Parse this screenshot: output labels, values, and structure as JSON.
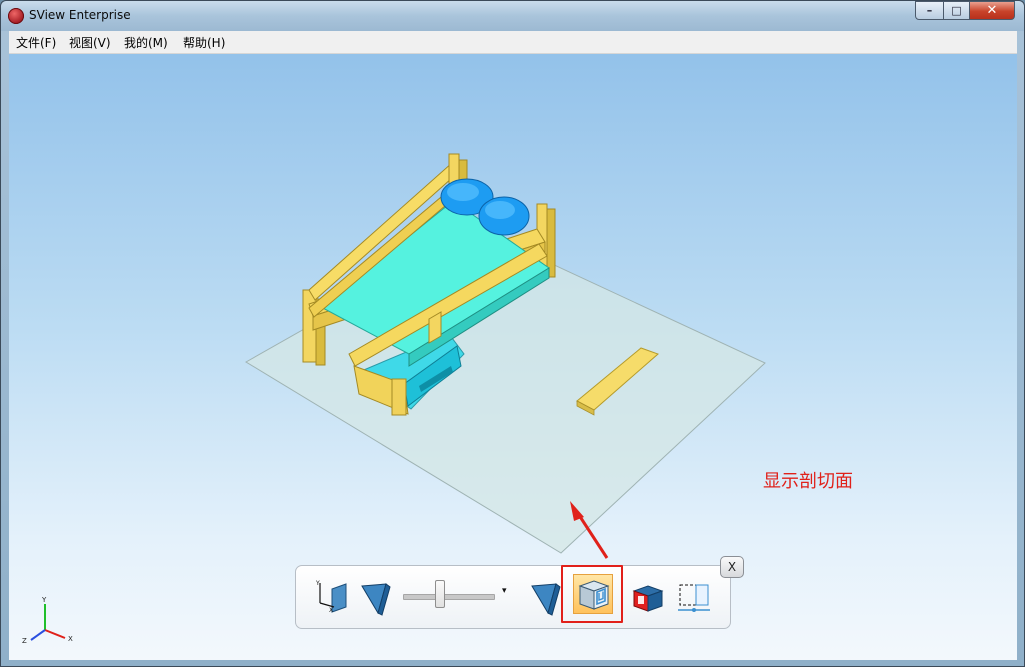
{
  "window": {
    "title": "SView Enterprise",
    "controls": {
      "minimize": "–",
      "maximize": "□",
      "close": "✕"
    }
  },
  "menu": {
    "items": [
      "文件(F)",
      "视图(V)",
      "我的(M)",
      "帮助(H)"
    ]
  },
  "annotation": {
    "text": "显示剖切面",
    "color": "#e0211a"
  },
  "axis_triad": {
    "labels": [
      "Y",
      "X",
      "Z"
    ]
  },
  "section_toolbar": {
    "close_label": "X",
    "buttons": [
      {
        "icon": "plane-xy-icon"
      },
      {
        "icon": "section-plane-icon"
      },
      {
        "icon": "slider"
      },
      {
        "icon": "dropdown-arrow-icon"
      },
      {
        "icon": "section-plane-icon"
      },
      {
        "icon": "show-section-icon",
        "active": true
      },
      {
        "icon": "section-cap-icon"
      },
      {
        "icon": "section-edge-icon"
      }
    ],
    "slider_value": 0.4
  },
  "colors": {
    "annotation_red": "#e0211a",
    "active_button": "#ffc25c",
    "mattress": "#4ff0de",
    "wood": "#f5d75c",
    "pillow": "#1e9cf0"
  }
}
